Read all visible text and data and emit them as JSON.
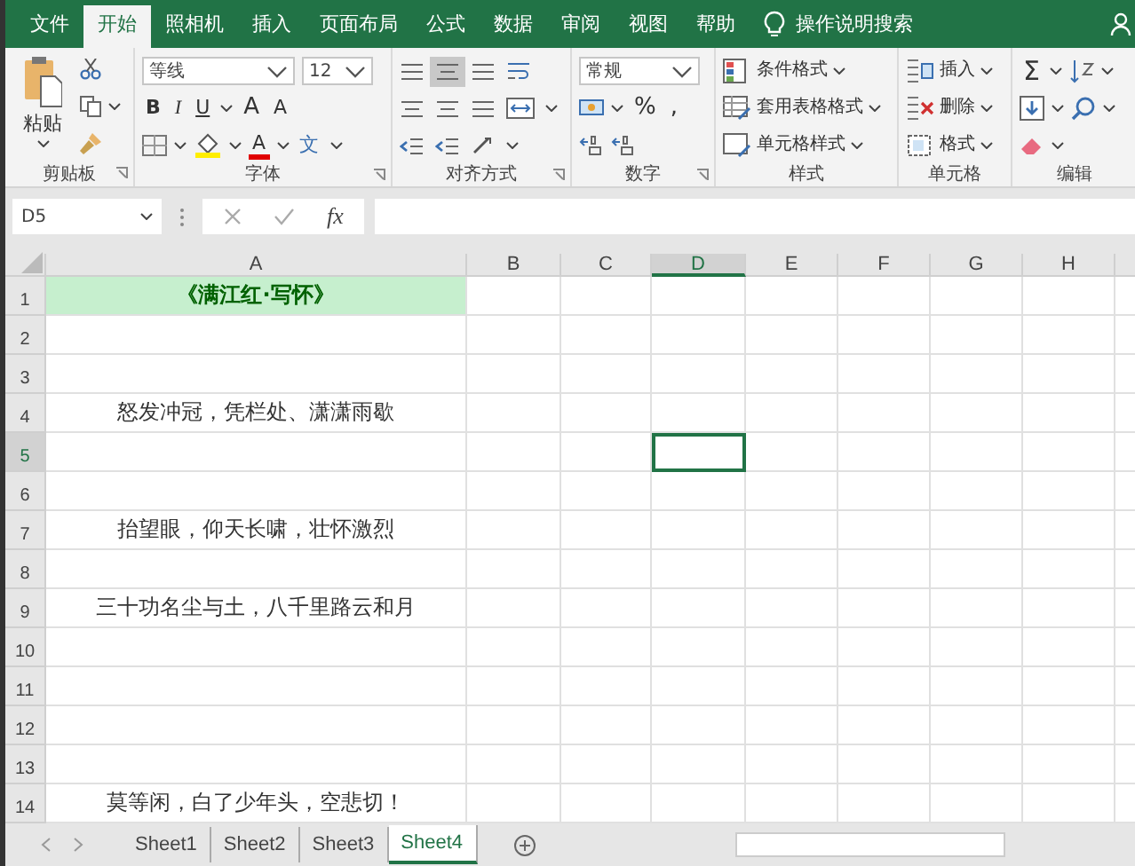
{
  "menu_tabs": [
    {
      "label": "文件",
      "selected": false
    },
    {
      "label": "开始",
      "selected": true
    },
    {
      "label": "照相机",
      "selected": false
    },
    {
      "label": "插入",
      "selected": false
    },
    {
      "label": "页面布局",
      "selected": false
    },
    {
      "label": "公式",
      "selected": false
    },
    {
      "label": "数据",
      "selected": false
    },
    {
      "label": "审阅",
      "selected": false
    },
    {
      "label": "视图",
      "selected": false
    },
    {
      "label": "帮助",
      "selected": false
    }
  ],
  "tell_me": "操作说明搜索",
  "ribbon": {
    "clipboard": {
      "label": "剪贴板",
      "paste": "粘贴"
    },
    "font": {
      "label": "字体",
      "font_name": "等线",
      "font_size": "12",
      "bold": "B",
      "italic": "I",
      "underline": "U",
      "grow": "A",
      "shrink": "A",
      "font_color": "A",
      "phonetic": "文"
    },
    "alignment": {
      "label": "对齐方式"
    },
    "number": {
      "label": "数字",
      "format": "常规",
      "percent": "%",
      "comma": ","
    },
    "styles": {
      "label": "样式",
      "items": [
        "条件格式",
        "套用表格格式",
        "单元格样式"
      ]
    },
    "cells": {
      "label": "单元格",
      "items": [
        "插入",
        "删除",
        "格式"
      ]
    },
    "editing": {
      "label": "编辑",
      "sum": "Σ"
    }
  },
  "formula_bar": {
    "name_box": "D5",
    "fx": "fx"
  },
  "grid": {
    "columns": [
      {
        "label": "A",
        "selected": false
      },
      {
        "label": "B",
        "selected": false
      },
      {
        "label": "C",
        "selected": false
      },
      {
        "label": "D",
        "selected": true
      },
      {
        "label": "E",
        "selected": false
      },
      {
        "label": "F",
        "selected": false
      },
      {
        "label": "G",
        "selected": false
      },
      {
        "label": "H",
        "selected": false
      }
    ],
    "rows": [
      {
        "number": "1",
        "selected": false,
        "kind": "title",
        "text": "《满江红·写怀》"
      },
      {
        "number": "2",
        "selected": false,
        "kind": "plain"
      },
      {
        "number": "3",
        "selected": false,
        "kind": "plain"
      },
      {
        "number": "4",
        "selected": false,
        "kind": "plain",
        "text": "怒发冲冠，凭栏处、潇潇雨歇"
      },
      {
        "number": "5",
        "selected": true,
        "kind": "plain"
      },
      {
        "number": "6",
        "selected": false,
        "kind": "plain"
      },
      {
        "number": "7",
        "selected": false,
        "kind": "plain",
        "text": "抬望眼，仰天长啸，壮怀激烈"
      },
      {
        "number": "8",
        "selected": false,
        "kind": "plain"
      },
      {
        "number": "9",
        "selected": false,
        "kind": "plain",
        "text": "三十功名尘与土，八千里路云和月"
      },
      {
        "number": "10",
        "selected": false,
        "kind": "plain"
      },
      {
        "number": "11",
        "selected": false,
        "kind": "plain"
      },
      {
        "number": "12",
        "selected": false,
        "kind": "plain"
      },
      {
        "number": "13",
        "selected": false,
        "kind": "plain"
      },
      {
        "number": "14",
        "selected": false,
        "kind": "plain",
        "text": "莫等闲，白了少年头，空悲切！"
      }
    ]
  },
  "sheets": [
    {
      "label": "Sheet1",
      "selected": false
    },
    {
      "label": "Sheet2",
      "selected": false
    },
    {
      "label": "Sheet3",
      "selected": false
    },
    {
      "label": "Sheet4",
      "selected": true
    }
  ]
}
